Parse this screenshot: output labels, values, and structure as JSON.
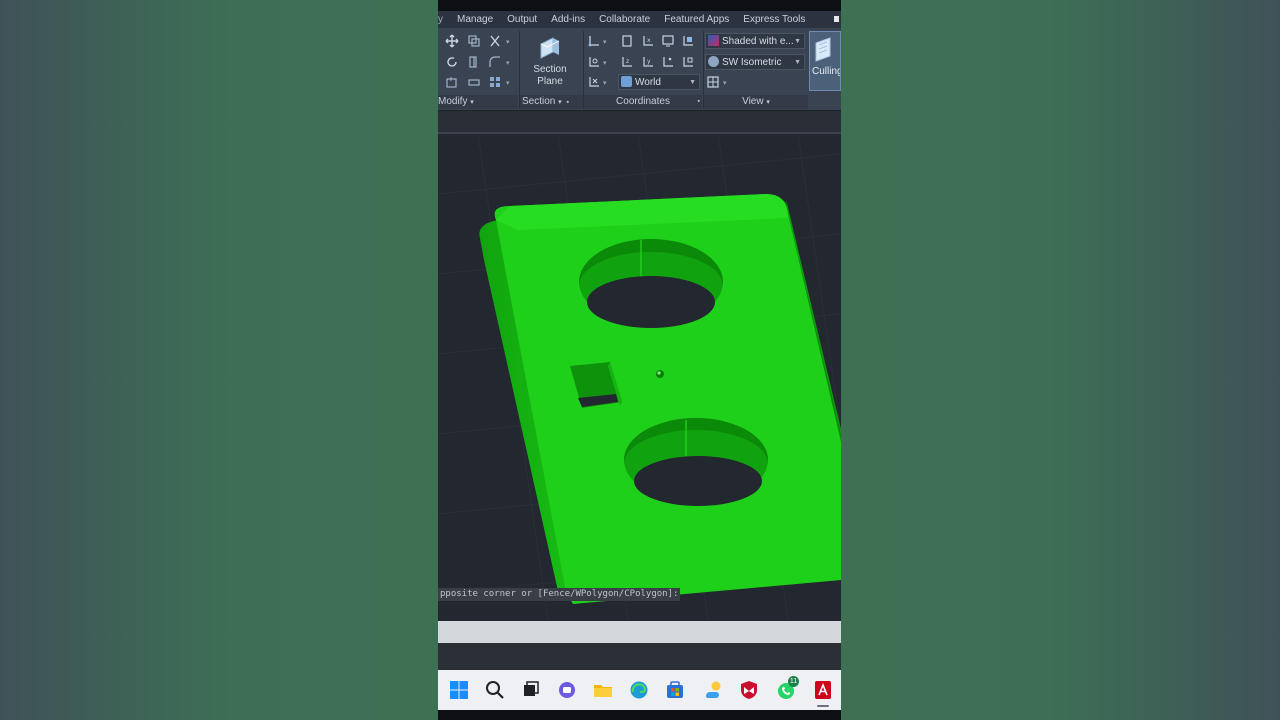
{
  "ribbon": {
    "tabs": [
      "y",
      "Manage",
      "Output",
      "Add-ins",
      "Collaborate",
      "Featured Apps",
      "Express Tools"
    ],
    "panels": {
      "modify": "Modify",
      "section": "Section",
      "coordinates": "Coordinates",
      "view": "View"
    },
    "section_plane_label_1": "Section",
    "section_plane_label_2": "Plane",
    "visual_style": "Shaded with e...",
    "view_preset": "SW Isometric",
    "ucs": "World",
    "culling_label": "Culling"
  },
  "command": {
    "prompt": "pposite corner or [Fence/WPolygon/CPolygon]:",
    "input_value": ""
  },
  "taskbar": {
    "icons": [
      "windows-start-icon",
      "search-icon",
      "task-view-icon",
      "chat-icon",
      "file-explorer-icon",
      "edge-icon",
      "store-icon",
      "weather-icon",
      "mcafee-icon",
      "whatsapp-icon",
      "autocad-icon"
    ],
    "whatsapp_badge": "11"
  },
  "colors": {
    "model": "#1fd01b",
    "viewport": "#23272f",
    "ribbon": "#3a4351"
  }
}
